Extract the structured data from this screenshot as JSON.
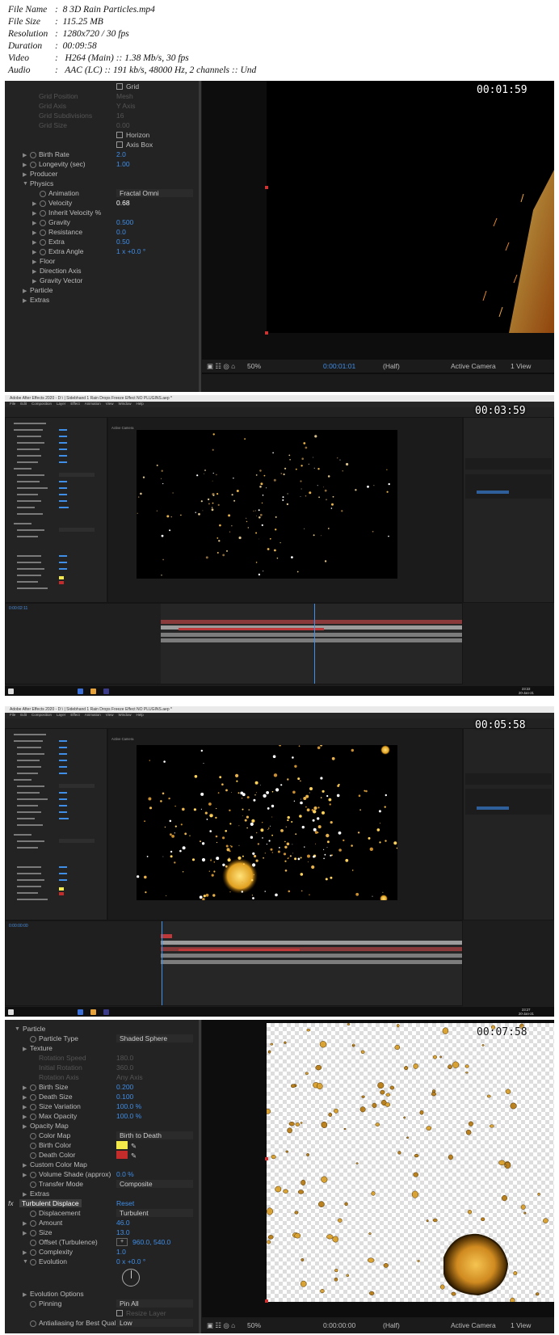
{
  "header": {
    "rows": [
      {
        "key": "File Name",
        "value": ":  8 3D Rain Particles.mp4"
      },
      {
        "key": "File Size",
        "value": ":  115.25 MB"
      },
      {
        "key": "Resolution",
        "value": ":  1280x720 / 30 fps"
      },
      {
        "key": "Duration",
        "value": ":  00:09:58"
      },
      {
        "key": "Video",
        "value": ":   H264 (Main) :: 1.38 Mb/s, 30 fps"
      },
      {
        "key": "Audio",
        "value": ":   AAC (LC) :: 191 kb/s, 48000 Hz, 2 channels :: Und"
      }
    ]
  },
  "frames": [
    {
      "timestamp": "00:01:59"
    },
    {
      "timestamp": "00:03:59"
    },
    {
      "timestamp": "00:05:58"
    },
    {
      "timestamp": "00:07:58"
    }
  ],
  "frame1": {
    "grid_label": "Grid",
    "faded": [
      "Grid Position",
      "Grid Axis",
      "Grid Subdivisions",
      "Grid Size"
    ],
    "faded_values": [
      "Mesh",
      "Y Axis",
      "16",
      "0.00"
    ],
    "horizon_label": "Horizon",
    "axis_box_label": "Axis Box",
    "rows": [
      {
        "label": "Birth Rate",
        "value": "2.0"
      },
      {
        "label": "Longevity (sec)",
        "value": "1.00"
      },
      {
        "label": "Producer",
        "value": ""
      },
      {
        "label": "Physics",
        "value": ""
      },
      {
        "label": "Animation",
        "value": "Fractal Omni"
      },
      {
        "label": "Velocity",
        "value": "0.68"
      },
      {
        "label": "Inherit Velocity %",
        "value": ""
      },
      {
        "label": "Gravity",
        "value": "0.500"
      },
      {
        "label": "Resistance",
        "value": "0.0"
      },
      {
        "label": "Extra",
        "value": "0.50"
      },
      {
        "label": "Extra Angle",
        "value": "1 x +0.0 °"
      },
      {
        "label": "Floor",
        "value": ""
      },
      {
        "label": "Direction Axis",
        "value": ""
      },
      {
        "label": "Gravity Vector",
        "value": ""
      },
      {
        "label": "Particle",
        "value": ""
      },
      {
        "label": "Extras",
        "value": ""
      }
    ],
    "viewer": {
      "zoom": "50%",
      "time": "0:00:01:01",
      "resolution": "(Half)",
      "camera": "Active Camera",
      "views": "1 View"
    }
  },
  "frame2": {
    "app_title": "Adobe After Effects 2020 - D:\\ | Sidebhand 1 Rain Drops Freeze Effect NO PLUGINS.aep *",
    "menus": [
      "File",
      "Edit",
      "Composition",
      "Layer",
      "Effect",
      "Animation",
      "View",
      "Window",
      "Help"
    ],
    "viewer_label": "Active Camera",
    "time": "0:00:02:11",
    "clock": "23:22",
    "date": "20-Jan-21"
  },
  "frame3": {
    "time": "0:00:00:00",
    "clock": "23:27",
    "date": "20-Jan-21"
  },
  "frame4": {
    "rows": [
      {
        "label": "Particle",
        "value": ""
      },
      {
        "label": "Particle Type",
        "value": "Shaded Sphere"
      },
      {
        "label": "Texture",
        "value": ""
      },
      {
        "label": "Rotation Speed",
        "value": "180.0"
      },
      {
        "label": "Initial Rotation",
        "value": "360.0"
      },
      {
        "label": "Rotation Axis",
        "value": "Any Axis"
      },
      {
        "label": "Birth Size",
        "value": "0.200"
      },
      {
        "label": "Death Size",
        "value": "0.100"
      },
      {
        "label": "Size Variation",
        "value": "100.0 %"
      },
      {
        "label": "Max Opacity",
        "value": "100.0 %"
      },
      {
        "label": "Opacity Map",
        "value": ""
      },
      {
        "label": "Color Map",
        "value": "Birth to Death"
      },
      {
        "label": "Birth Color",
        "value": ""
      },
      {
        "label": "Death Color",
        "value": ""
      },
      {
        "label": "Custom Color Map",
        "value": ""
      },
      {
        "label": "Volume Shade (approx)",
        "value": "0.0 %"
      },
      {
        "label": "Transfer Mode",
        "value": "Composite"
      },
      {
        "label": "Extras",
        "value": ""
      },
      {
        "label": "Turbulent Displace",
        "value": "Reset"
      },
      {
        "label": "Displacement",
        "value": "Turbulent"
      },
      {
        "label": "Amount",
        "value": "46.0"
      },
      {
        "label": "Size",
        "value": "13.0"
      },
      {
        "label": "Offset (Turbulence)",
        "value": "960.0, 540.0"
      },
      {
        "label": "Complexity",
        "value": "1.0"
      },
      {
        "label": "Evolution",
        "value": "0 x +0.0 °"
      },
      {
        "label": "Evolution Options",
        "value": ""
      },
      {
        "label": "Pinning",
        "value": "Pin All"
      },
      {
        "label": "Resize Layer",
        "value": ""
      },
      {
        "label": "Antialiasing for Best Quality",
        "value": "Low"
      }
    ],
    "viewer": {
      "zoom": "50%",
      "time": "0:00:00:00",
      "resolution": "(Half)",
      "camera": "Active Camera",
      "views": "1 View"
    }
  },
  "colors": {
    "accent_blue": "#3f8ee8",
    "birth_color": "#f3e94a",
    "death_color": "#c42b2b",
    "particle_orange": "#e8a030"
  }
}
